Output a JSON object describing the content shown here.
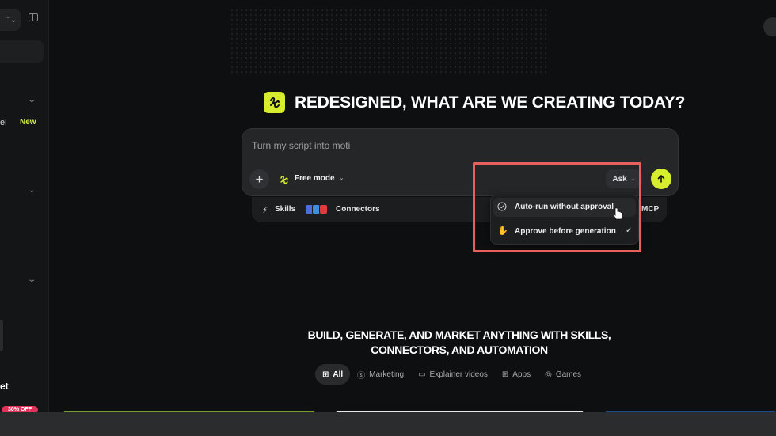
{
  "sidebar": {
    "chip_glyph": "⌃⌄",
    "item_label_partial": "el",
    "new_badge": "New",
    "bottom_label_partial": "et",
    "promo_badge": "30% OFF"
  },
  "header": {
    "title": "REDESIGNED, WHAT ARE WE CREATING TODAY?"
  },
  "prompt": {
    "text": "Turn my script into moti",
    "add_glyph": "+",
    "mode_label": "Free mode",
    "ask_label": "Ask"
  },
  "tools": {
    "skills_label": "Skills",
    "connectors_label": "Connectors",
    "mcp_label": "MCP"
  },
  "dropdown": {
    "items": [
      {
        "label": "Auto-run without approval",
        "icon": "check-circle-icon",
        "selected": false
      },
      {
        "label": "Approve before generation",
        "icon": "hand-icon",
        "selected": true
      }
    ]
  },
  "section": {
    "title_line1": "BUILD, GENERATE, AND MARKET ANYTHING WITH SKILLS,",
    "title_line2": "CONNECTORS, AND AUTOMATION"
  },
  "categories": [
    {
      "label": "All",
      "icon": "grid-icon",
      "active": true
    },
    {
      "label": "Marketing",
      "icon": "dollar-icon",
      "active": false
    },
    {
      "label": "Explainer videos",
      "icon": "video-icon",
      "active": false
    },
    {
      "label": "Apps",
      "icon": "apps-icon",
      "active": false
    },
    {
      "label": "Games",
      "icon": "gamepad-icon",
      "active": false
    }
  ],
  "colors": {
    "accent": "#d7ee2e",
    "highlight": "#e8605d",
    "background": "#0e0f10"
  }
}
